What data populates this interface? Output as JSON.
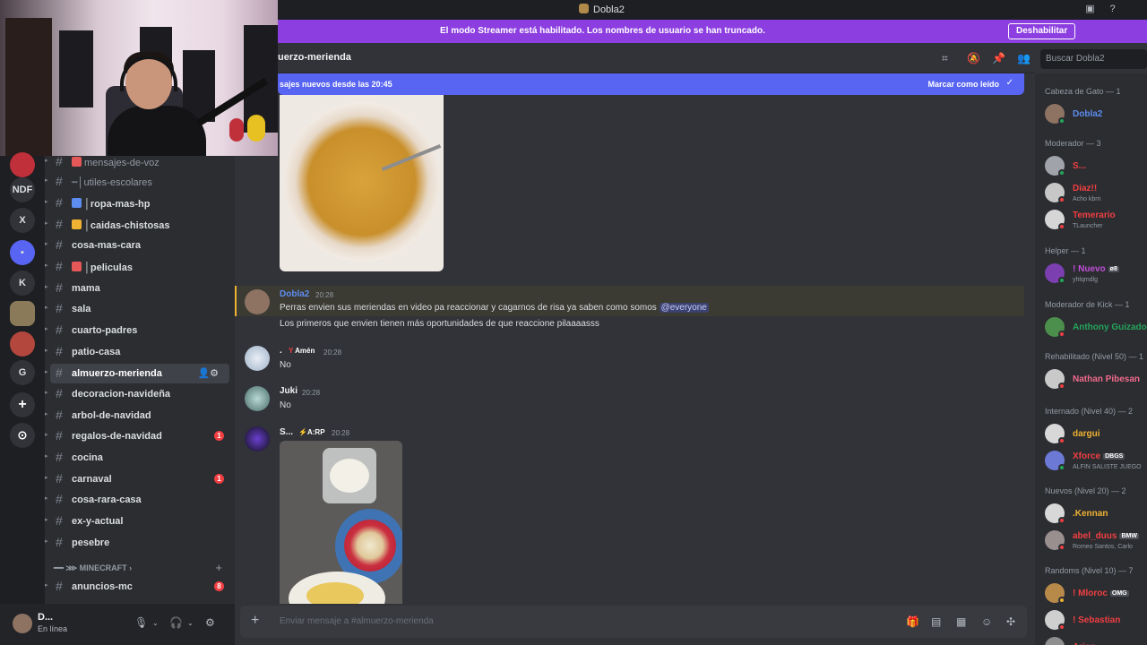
{
  "window": {
    "title": "Dobla2"
  },
  "streamer_banner": {
    "message": "El modo Streamer está habilitado. Los nombres de usuario se han truncado.",
    "button": "Deshabilitar"
  },
  "servers": [
    {
      "label": "",
      "color": "#c0303b"
    },
    {
      "label": "NDF",
      "color": "#1e1f22"
    },
    {
      "label": "X",
      "color": "#1e1f22"
    },
    {
      "label": "",
      "color": "#5865f2"
    },
    {
      "label": "K",
      "color": "#1e1f22"
    },
    {
      "label": "",
      "color": "#8a7a5a"
    },
    {
      "label": "",
      "color": "#b3463d"
    },
    {
      "label": "G",
      "color": "#1e1f22"
    }
  ],
  "channels": [
    {
      "name": "mensajes-de-voz",
      "dim": true,
      "emoji": "#e45858"
    },
    {
      "name": "┉│utiles-escolares",
      "dim": true
    },
    {
      "name": "│ropa-mas-hp",
      "emoji": "#5e8df0"
    },
    {
      "name": "│caidas-chistosas",
      "emoji": "#f0b232"
    },
    {
      "name": "cosa-mas-cara"
    },
    {
      "name": "│peliculas",
      "emoji": "#e45858"
    },
    {
      "name": "mama"
    },
    {
      "name": "sala"
    },
    {
      "name": "cuarto-padres"
    },
    {
      "name": "patio-casa"
    },
    {
      "name": "almuerzo-merienda",
      "active": true
    },
    {
      "name": "decoracion-navideña"
    },
    {
      "name": "arbol-de-navidad"
    },
    {
      "name": "regalos-de-navidad",
      "badge": "1"
    },
    {
      "name": "cocina"
    },
    {
      "name": "carnaval",
      "badge": "1"
    },
    {
      "name": "cosa-rara-casa"
    },
    {
      "name": "ex-y-actual"
    },
    {
      "name": "pesebre"
    }
  ],
  "category": {
    "label": "━━ ⋙ MINECRAFT ›"
  },
  "category_channels": [
    {
      "name": "anuncios-mc",
      "badge": "8"
    }
  ],
  "user": {
    "name": "D...",
    "status": "En línea"
  },
  "channel_header": {
    "name": "uerzo-merienda",
    "search_placeholder": "Buscar Dobla2"
  },
  "new_messages": {
    "text": "sajes nuevos desde las 20:45",
    "mark_read": "Marcar como leído"
  },
  "messages": [
    {
      "author": "Dobla2",
      "time": "20:28",
      "line1": "Perras envien sus meriendas en video pa reaccionar y cagarnos de risa ya saben como somos",
      "mention": "@everyone",
      "line2": "Los primeros que envien tienen más oportunidades de que reaccione pilaaaasss",
      "author_color": "#5e8df0"
    },
    {
      "author": ".",
      "tag": "Amén",
      "time": "20:28",
      "text": "No",
      "author_color": "#f2f3f5"
    },
    {
      "author": "Juki",
      "time": "20:28",
      "text": "No",
      "author_color": "#f2f3f5"
    },
    {
      "author": "S...",
      "tag": "A:RP",
      "time": "20:28",
      "author_color": "#f2f3f5"
    }
  ],
  "composer": {
    "placeholder": "Enviar mensaje a #almuerzo-merienda"
  },
  "members": {
    "groups": [
      {
        "label": "Cabeza de Gato — 1"
      },
      {
        "label": "Moderador — 3"
      },
      {
        "label": "Helper — 1"
      },
      {
        "label": "Moderador de Kick — 1"
      },
      {
        "label": "Rehabilitado (Nivel 50) — 1"
      },
      {
        "label": "Internado (Nivel 40) — 2"
      },
      {
        "label": "Nuevos (Nivel 20) — 2"
      },
      {
        "label": "Randoms (Nivel 10) — 7"
      }
    ],
    "list": [
      {
        "name": "Dobla2",
        "color": "#5e8df0",
        "avatar": "#8e7363",
        "status": "#23a55a"
      },
      {
        "name": "S...",
        "color": "#f23f42",
        "avatar": "#a0a4aa",
        "status": "#23a55a"
      },
      {
        "name": "Diaz!!",
        "sub": "Acho kbrn",
        "color": "#f23f42",
        "avatar": "#c7c7c7",
        "status": "#f23f42"
      },
      {
        "name": "Temerario",
        "sub": "TLauncher",
        "color": "#f23f42",
        "avatar": "#d6d6d6",
        "status": "#f23f42"
      },
      {
        "name": "! Nuevo",
        "tag": "ø8",
        "sub": "yhlqmdlg",
        "color": "#c04fd6",
        "avatar": "#7b3fb0",
        "status": "#23a55a"
      },
      {
        "name": "Anthony Guizado",
        "color": "#23a55a",
        "avatar": "#4c8f4c",
        "status": "#f23f42"
      },
      {
        "name": "Nathan Pibesan",
        "color": "#f06a8c",
        "avatar": "#c9c9c9",
        "status": "#f23f42"
      },
      {
        "name": "dargui",
        "color": "#f0b232",
        "avatar": "#d8d8d8",
        "status": "#f23f42"
      },
      {
        "name": "Xforce",
        "tag": "DBGS",
        "sub": "ALFIN SALISTE JUEGO",
        "color": "#f23f42",
        "avatar": "#6c7ad6",
        "status": "#23a55a"
      },
      {
        "name": ".Kennan",
        "color": "#f0b232",
        "avatar": "#d8d8d8",
        "status": "#f23f42"
      },
      {
        "name": "abel_duus",
        "tag": "BMW",
        "sub": "Romeo Santos, Carlo",
        "color": "#f23f42",
        "avatar": "#9a8f8f",
        "status": "#f23f42"
      },
      {
        "name": "! Mloroc",
        "tag": "OMG",
        "color": "#f23f42",
        "avatar": "#b88a4a",
        "status": "#f0b232"
      },
      {
        "name": "! Sebastian",
        "color": "#f23f42",
        "avatar": "#cfcfcf",
        "status": "#f23f42"
      },
      {
        "name": "Arian",
        "color": "#f23f42",
        "avatar": "#8f8f8f",
        "status": "#f23f42"
      }
    ]
  }
}
